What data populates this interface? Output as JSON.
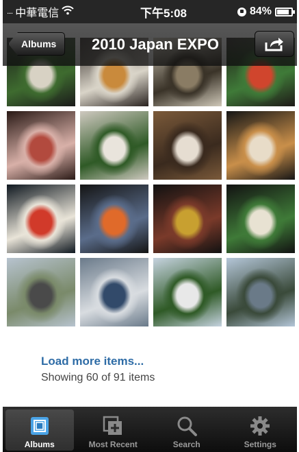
{
  "status_bar": {
    "carrier": "中華電信",
    "signal": "....",
    "time": "下午5:08",
    "battery_percent": "84%",
    "battery_level": 0.84
  },
  "nav": {
    "back_label": "Albums",
    "title": "2010 Japan EXPO",
    "share_icon": "share-icon"
  },
  "photos": [
    {
      "name": "photo-1",
      "colors": [
        "#1b1b1b",
        "#d8d2c4",
        "#3e6b2f"
      ]
    },
    {
      "name": "photo-2",
      "colors": [
        "#2a2320",
        "#c98a3c",
        "#d9d4c8"
      ]
    },
    {
      "name": "photo-3",
      "colors": [
        "#cfc8b8",
        "#8a7c64",
        "#3a3328"
      ]
    },
    {
      "name": "photo-4",
      "colors": [
        "#1f1a18",
        "#d0452d",
        "#3f7a38"
      ]
    },
    {
      "name": "photo-5",
      "colors": [
        "#2a1a16",
        "#b24a3e",
        "#d8b0a8"
      ]
    },
    {
      "name": "photo-6",
      "colors": [
        "#cfc9c0",
        "#e9e4dc",
        "#2f5a26"
      ]
    },
    {
      "name": "photo-7",
      "colors": [
        "#7b5a3a",
        "#e6ddd1",
        "#3a2a1e"
      ]
    },
    {
      "name": "photo-8",
      "colors": [
        "#161616",
        "#e8dcc8",
        "#c98f4a"
      ]
    },
    {
      "name": "photo-9",
      "colors": [
        "#0f1820",
        "#d13a2a",
        "#e9e4d8"
      ]
    },
    {
      "name": "photo-10",
      "colors": [
        "#141414",
        "#e06a2a",
        "#5a6c8a"
      ]
    },
    {
      "name": "photo-11",
      "colors": [
        "#111111",
        "#c8a030",
        "#7a3a2a"
      ]
    },
    {
      "name": "photo-12",
      "colors": [
        "#121212",
        "#e8e2d2",
        "#3f7a38"
      ]
    },
    {
      "name": "photo-13",
      "colors": [
        "#b7c3cf",
        "#4a4a4a",
        "#7a8a6a"
      ]
    },
    {
      "name": "photo-14",
      "colors": [
        "#6a7a8a",
        "#324a6a",
        "#d8dce0"
      ]
    },
    {
      "name": "photo-15",
      "colors": [
        "#c6d3e0",
        "#e8e8e8",
        "#2f5a26"
      ]
    },
    {
      "name": "photo-16",
      "colors": [
        "#b4c6d8",
        "#6a7a88",
        "#3a4a3a"
      ]
    }
  ],
  "load_more": {
    "label": "Load more items...",
    "status": "Showing 60 of 91 items"
  },
  "tabs": [
    {
      "label": "Albums",
      "icon": "albums-icon",
      "active": true
    },
    {
      "label": "Most Recent",
      "icon": "most-recent-icon",
      "active": false
    },
    {
      "label": "Search",
      "icon": "search-icon",
      "active": false
    },
    {
      "label": "Settings",
      "icon": "settings-icon",
      "active": false
    }
  ]
}
